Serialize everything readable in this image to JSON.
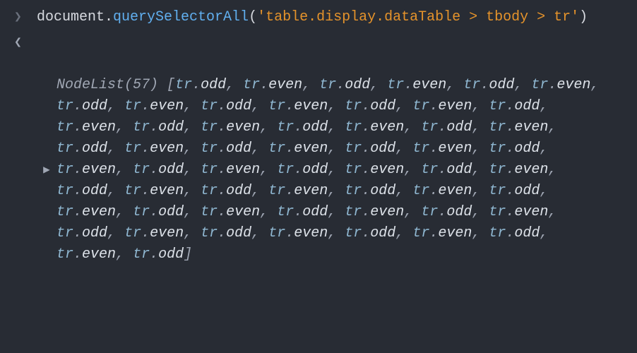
{
  "input": {
    "obj": "document",
    "method": "querySelectorAll",
    "arg": "'table.display.dataTable > tbody > tr'"
  },
  "output": {
    "constructor_name": "NodeList",
    "count": 57,
    "items": [
      "tr.odd",
      "tr.even",
      "tr.odd",
      "tr.even",
      "tr.odd",
      "tr.even",
      "tr.odd",
      "tr.even",
      "tr.odd",
      "tr.even",
      "tr.odd",
      "tr.even",
      "tr.odd",
      "tr.even",
      "tr.odd",
      "tr.even",
      "tr.odd",
      "tr.even",
      "tr.odd",
      "tr.even",
      "tr.odd",
      "tr.even",
      "tr.odd",
      "tr.even",
      "tr.odd",
      "tr.even",
      "tr.odd",
      "tr.even",
      "tr.odd",
      "tr.even",
      "tr.odd",
      "tr.even",
      "tr.odd",
      "tr.even",
      "tr.odd",
      "tr.even",
      "tr.odd",
      "tr.even",
      "tr.odd",
      "tr.even",
      "tr.odd",
      "tr.even",
      "tr.odd",
      "tr.even",
      "tr.odd",
      "tr.even",
      "tr.odd",
      "tr.even",
      "tr.odd",
      "tr.even",
      "tr.odd",
      "tr.even",
      "tr.odd",
      "tr.even",
      "tr.odd",
      "tr.even",
      "tr.odd"
    ]
  },
  "glyphs": {
    "input_prompt": "❯",
    "output_prompt": "❮",
    "expand": "▶"
  }
}
